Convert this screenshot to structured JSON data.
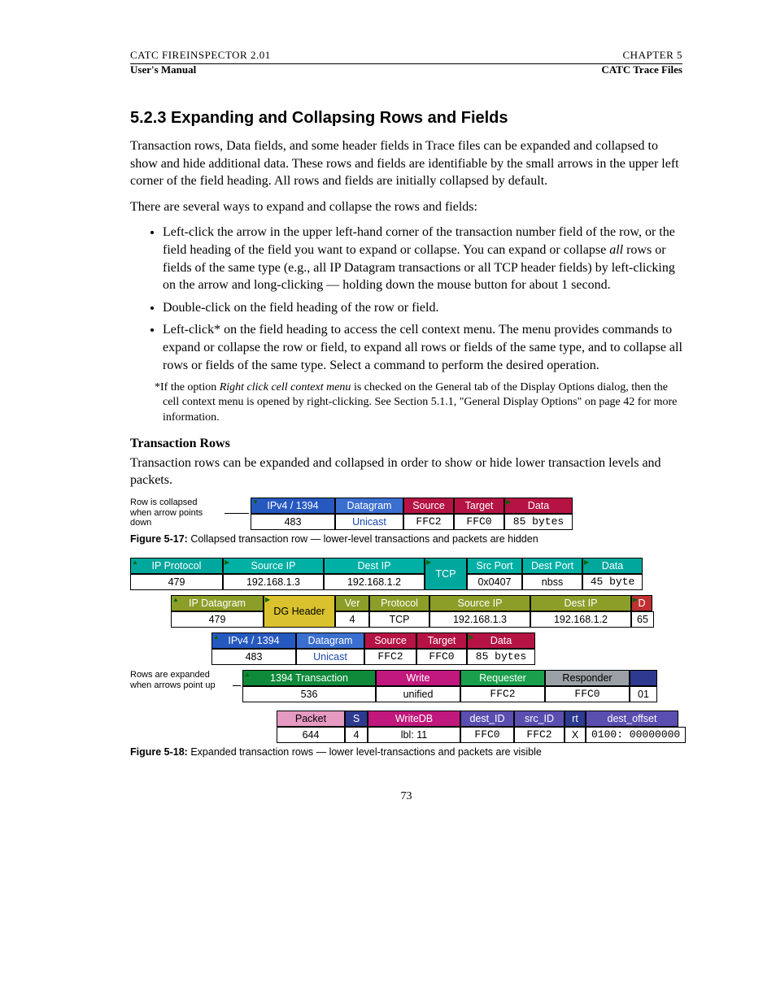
{
  "header": {
    "top_left": "CATC FIREINSPECTOR 2.01",
    "top_right": "CHAPTER 5",
    "bold_left": "User's Manual",
    "bold_right": "CATC Trace Files"
  },
  "section_title": "5.2.3 Expanding and Collapsing Rows and Fields",
  "para1": "Transaction rows, Data fields, and some header fields in Trace files can be expanded and collapsed to show and hide additional data. These rows and fields are identifiable by the small arrows in the upper left corner of the field heading. All rows and fields are initially collapsed by default.",
  "para2": "There are several ways to expand and collapse the rows and fields:",
  "bullets": [
    {
      "pre": "Left-click the arrow in the upper left-hand corner of the transaction number field of the row, or the field heading of the field you want to expand or collapse. You can expand or collapse ",
      "em": "all",
      "post": " rows or fields of the same type (e.g., all IP Datagram transactions or all TCP header fields) by left-clicking on the arrow and long-clicking — holding down the mouse button for about 1 second."
    },
    {
      "pre": "Double-click on the field heading of the row or field.",
      "em": "",
      "post": ""
    },
    {
      "pre": "Left-click* on the field heading to access the cell context menu. The menu provides commands to expand or collapse the row or field, to expand all rows or fields of the same type, and to collapse all rows or fields of the same type. Select a command to perform the desired operation.",
      "em": "",
      "post": ""
    }
  ],
  "footnote": {
    "star": "*",
    "pre": "If the option ",
    "em": "Right click cell context menu",
    "post": " is checked on the General tab of the Display Options dialog, then the cell context menu is opened by right-clicking. See Section 5.1.1, \"General Display Options\" on page 42 for more information."
  },
  "subsection": "Transaction Rows",
  "para3": "Transaction rows can be expanded and collapsed in order to show or hide lower transaction levels and packets.",
  "fig17": {
    "sidecap": "Row is collapsed when arrow points down",
    "caption_label": "Figure 5-17:",
    "caption_text": "Collapsed transaction row — lower-level transactions and packets are hidden",
    "cells": {
      "ipv4": "IPv4 / 1394",
      "ipv4_val": "483",
      "dgram": "Datagram",
      "dgram_val": "Unicast",
      "src": "Source",
      "src_val": "FFC2",
      "tgt": "Target",
      "tgt_val": "FFC0",
      "data": "Data",
      "data_val": "85 bytes"
    }
  },
  "fig18": {
    "sidecap": "Rows are expanded when arrows point up",
    "caption_label": "Figure 5-18:",
    "caption_text": "Expanded transaction rows — lower level-transactions and packets are visible",
    "r1": {
      "ipproto": "IP Protocol",
      "ipproto_val": "479",
      "srcip": "Source IP",
      "srcip_val": "192.168.1.3",
      "destip": "Dest IP",
      "destip_val": "192.168.1.2",
      "tcp": "TCP",
      "srcport": "Src Port",
      "srcport_val": "0x0407",
      "destport": "Dest Port",
      "destport_val": "nbss",
      "data": "Data",
      "data_val": "45 byte"
    },
    "r2": {
      "ipdg": "IP Datagram",
      "ipdg_val": "479",
      "dghdr": "DG Header",
      "ver": "Ver",
      "ver_val": "4",
      "proto": "Protocol",
      "proto_val": "TCP",
      "srcip": "Source IP",
      "srcip_val": "192.168.1.3",
      "destip": "Dest IP",
      "destip_val": "192.168.1.2",
      "d": "D",
      "d_val": "65"
    },
    "r3": {
      "ipv4": "IPv4 / 1394",
      "ipv4_val": "483",
      "dgram": "Datagram",
      "dgram_val": "Unicast",
      "src": "Source",
      "src_val": "FFC2",
      "tgt": "Target",
      "tgt_val": "FFC0",
      "data": "Data",
      "data_val": "85 bytes"
    },
    "r4": {
      "tx": "1394 Transaction",
      "tx_val": "536",
      "wr": "Write",
      "wr_val": "unified",
      "req": "Requester",
      "req_val": "FFC2",
      "resp": "Responder",
      "resp_val": "FFC0",
      "tail": "01"
    },
    "r5": {
      "pkt": "Packet",
      "pkt_val": "644",
      "s": "S",
      "s_val": "4",
      "wdb": "WriteDB",
      "wdb_val": "lbl: 11",
      "did": "dest_ID",
      "did_val": "FFC0",
      "sid": "src_ID",
      "sid_val": "FFC2",
      "rt": "rt",
      "rt_val": "X",
      "doff": "dest_offset",
      "doff_val": "0100: 00000000"
    }
  },
  "pagenum": "73"
}
